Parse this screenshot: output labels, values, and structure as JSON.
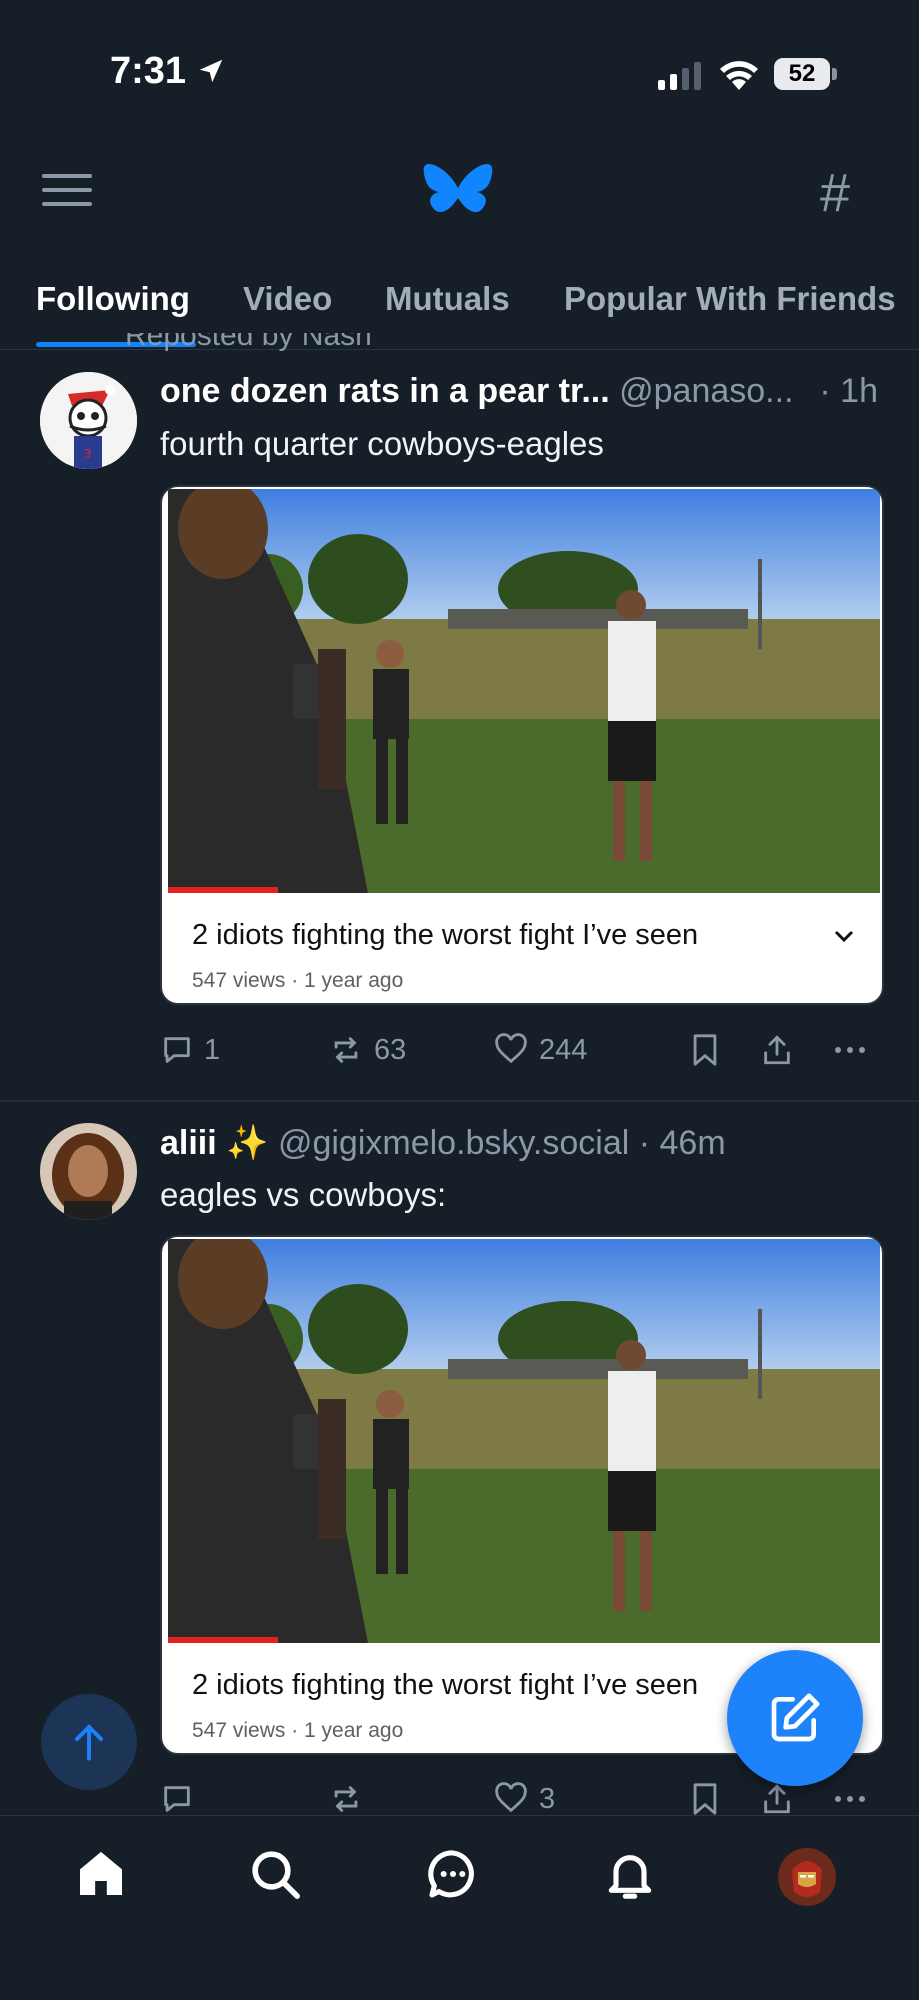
{
  "status_bar": {
    "time": "7:31",
    "battery": "52"
  },
  "header": {
    "logo": "butterfly-logo",
    "menu_icon": "hamburger-icon",
    "feeds_icon": "hashtag-icon"
  },
  "tabs": [
    {
      "label": "Following",
      "active": true
    },
    {
      "label": "Video",
      "active": false
    },
    {
      "label": "Mutuals",
      "active": false
    },
    {
      "label": "Popular With Friends",
      "active": false
    }
  ],
  "posts": [
    {
      "repost_text": "Reposted by Nash",
      "author": "one dozen rats in a pear tr...",
      "handle": "@panaso...",
      "time": "· 1h",
      "text": "fourth quarter cowboys-eagles",
      "video": {
        "title": "2 idiots fighting the worst fight I’ve seen",
        "meta": "547 views · 1 year ago"
      },
      "replies": "1",
      "reposts": "63",
      "likes": "244"
    },
    {
      "author": "aliii ✨",
      "handle": "@gigixmelo.bsky.social",
      "time": "· 46m",
      "text": "eagles vs cowboys:",
      "video": {
        "title": "2 idiots fighting the worst fight I’ve seen",
        "meta": "547 views · 1 year ago"
      },
      "replies": "",
      "reposts": "",
      "likes": "3"
    }
  ],
  "colors": {
    "background": "#161e27",
    "accent": "#1083fe",
    "muted": "#8b98a8"
  },
  "bottom_nav": [
    "home-icon",
    "search-icon",
    "chat-icon",
    "bell-icon",
    "profile-avatar"
  ]
}
